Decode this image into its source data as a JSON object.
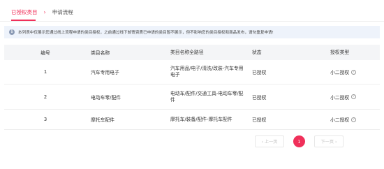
{
  "breadcrumb": {
    "items": [
      "已授权类目",
      "申请流程"
    ],
    "separator": "›"
  },
  "notice": {
    "icon": "info-icon",
    "text": "本列表中仅展示您通过线上流程申请的类目授权，之前通过线下邮寄资质已申请的类目暂不展示，但不影响您的类目授权和商品发布，请勿重复申请!"
  },
  "table": {
    "headers": [
      "编号",
      "类目名称",
      "类目名称全路径",
      "状态",
      "授权类型"
    ],
    "rows": [
      {
        "no": "1",
        "name": "汽车专用电子",
        "path": "汽车用品/电子/清洗/改装-汽车专用电子",
        "status": "已授权",
        "type": "小二授权"
      },
      {
        "no": "2",
        "name": "电动车零/配件",
        "path": "电动车/配件/交通工具-电动车零/配件",
        "status": "已授权",
        "type": "小二授权"
      },
      {
        "no": "3",
        "name": "摩托车配件",
        "path": "摩托车/装备/配件-摩托车配件",
        "status": "已授权",
        "type": "小二授权"
      }
    ]
  },
  "pagination": {
    "prev": "‹ 上一页",
    "current": "1",
    "next": "下一页 ›"
  },
  "colors": {
    "accent": "#f0305a",
    "notice_bg": "#eef3fb",
    "header_bg": "#f4f5f7"
  }
}
